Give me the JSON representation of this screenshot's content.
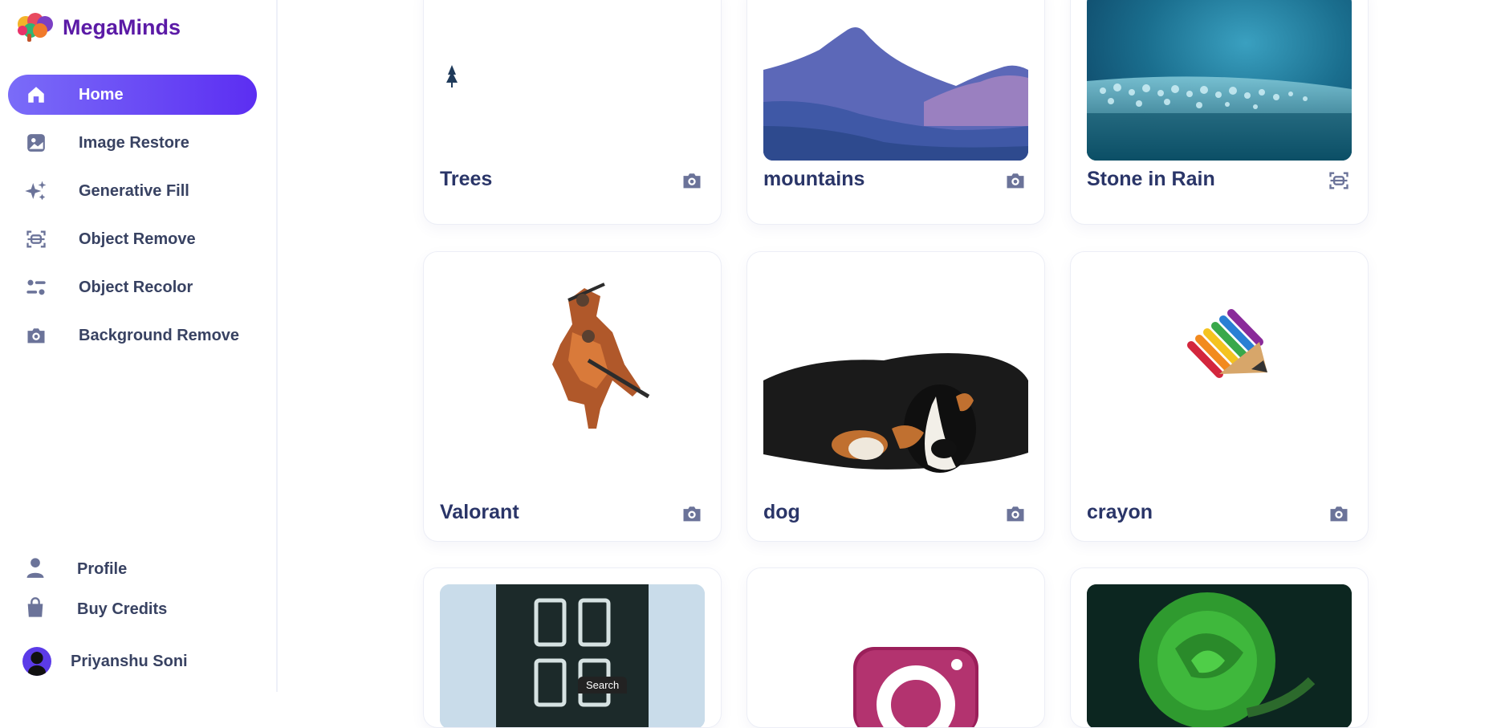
{
  "app": {
    "name": "MegaMinds"
  },
  "nav": [
    {
      "label": "Home",
      "icon": "home-icon",
      "active": true
    },
    {
      "label": "Image Restore",
      "icon": "image-icon",
      "active": false
    },
    {
      "label": "Generative Fill",
      "icon": "stars-icon",
      "active": false
    },
    {
      "label": "Object Remove",
      "icon": "scan-icon",
      "active": false
    },
    {
      "label": "Object Recolor",
      "icon": "filter-icon",
      "active": false
    },
    {
      "label": "Background Remove",
      "icon": "camera-icon",
      "active": false
    }
  ],
  "bottom": {
    "profile": "Profile",
    "credits": "Buy Credits",
    "user_name": "Priyanshu Soni"
  },
  "cards": [
    {
      "title": "Trees",
      "icon": "camera-icon"
    },
    {
      "title": "mountains",
      "icon": "camera-icon"
    },
    {
      "title": "Stone in Rain",
      "icon": "scan-icon"
    },
    {
      "title": "Valorant",
      "icon": "camera-icon"
    },
    {
      "title": "dog",
      "icon": "camera-icon"
    },
    {
      "title": "crayon",
      "icon": "camera-icon"
    },
    {
      "title": "",
      "icon": ""
    },
    {
      "title": "",
      "icon": ""
    },
    {
      "title": "",
      "icon": ""
    }
  ],
  "tooltip": {
    "search": "Search"
  },
  "colors": {
    "accent": "#5c2ef2",
    "title": "#2a3568",
    "icon": "#6b7399"
  }
}
